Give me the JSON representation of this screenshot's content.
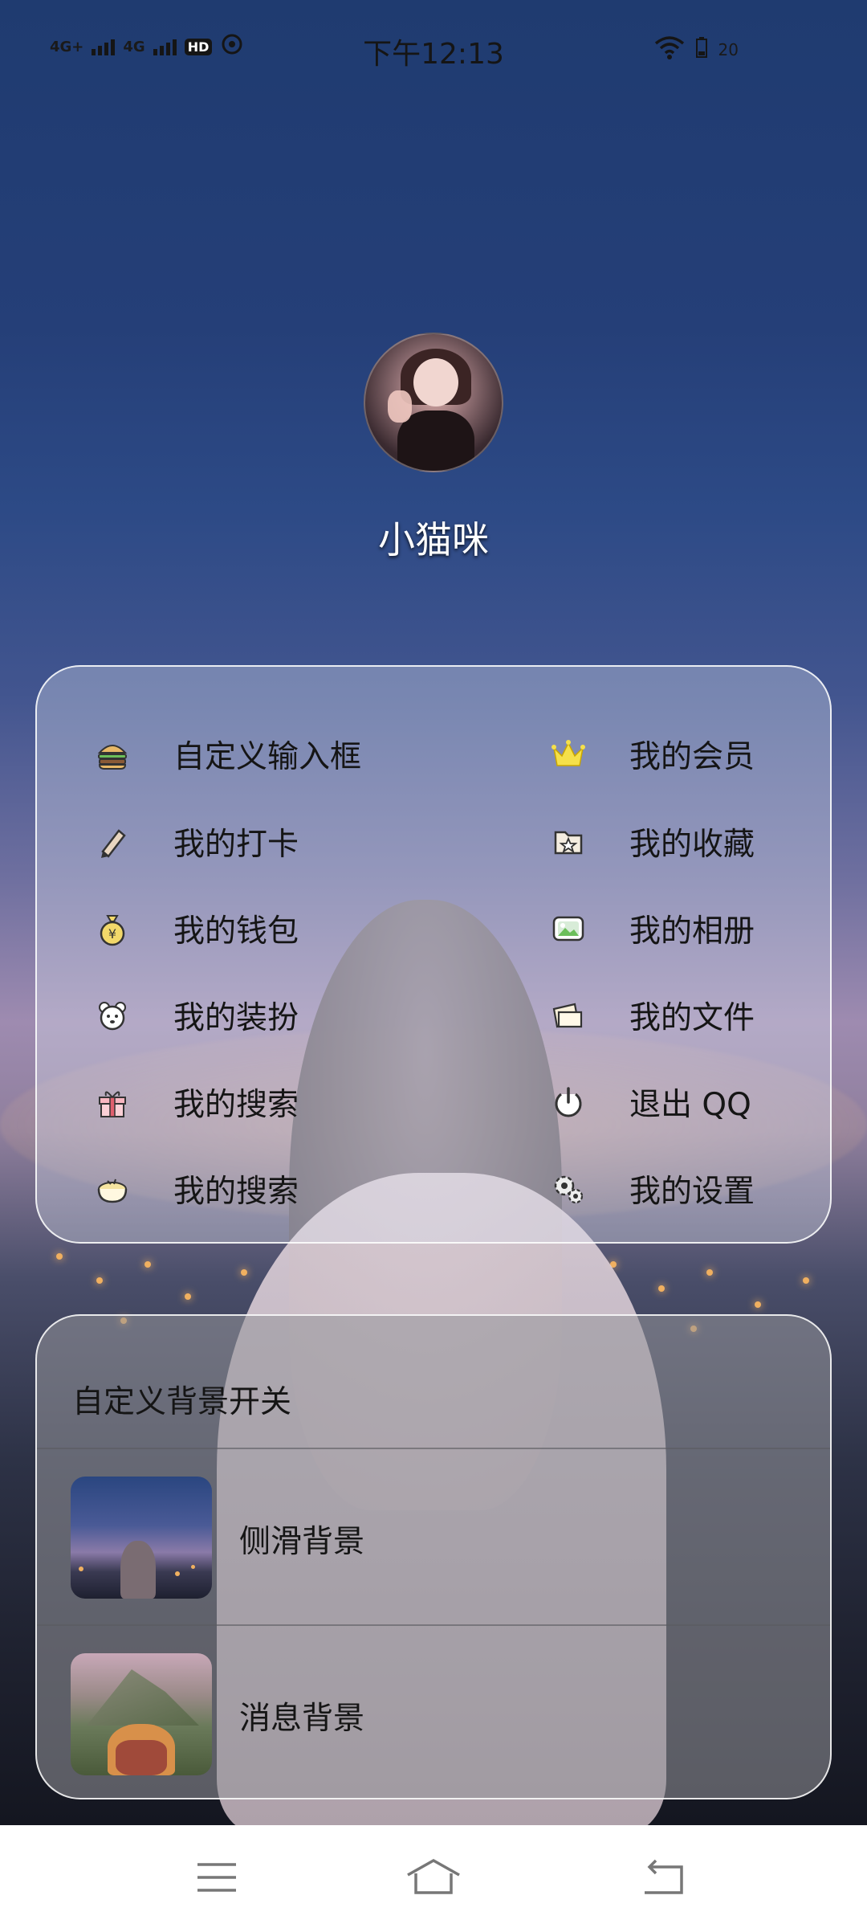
{
  "status_bar": {
    "network_1": "4G+",
    "network_2": "4G",
    "hd": "HD",
    "time": "下午12:13",
    "battery": "20"
  },
  "profile": {
    "username": "小猫咪"
  },
  "menu": {
    "left": [
      {
        "label": "自定义输入框",
        "icon": "burger-icon"
      },
      {
        "label": "我的打卡",
        "icon": "pencil-icon"
      },
      {
        "label": "我的钱包",
        "icon": "money-bag-icon"
      },
      {
        "label": "我的装扮",
        "icon": "bear-face-icon"
      },
      {
        "label": "我的搜索",
        "icon": "gift-box-icon"
      },
      {
        "label": "我的搜索",
        "icon": "bowl-icon"
      }
    ],
    "right": [
      {
        "label": "我的会员",
        "icon": "crown-icon"
      },
      {
        "label": "我的收藏",
        "icon": "star-folder-icon"
      },
      {
        "label": "我的相册",
        "icon": "photo-icon"
      },
      {
        "label": "我的文件",
        "icon": "files-icon"
      },
      {
        "label": "退出 QQ",
        "icon": "power-icon"
      },
      {
        "label": "我的设置",
        "icon": "settings-icon"
      }
    ]
  },
  "background_settings": {
    "title": "自定义背景开关",
    "items": [
      {
        "label": "侧滑背景"
      },
      {
        "label": "消息背景"
      }
    ]
  },
  "colors": {
    "accent_crown": "#f5e04a",
    "card_border": "#ffffff"
  }
}
